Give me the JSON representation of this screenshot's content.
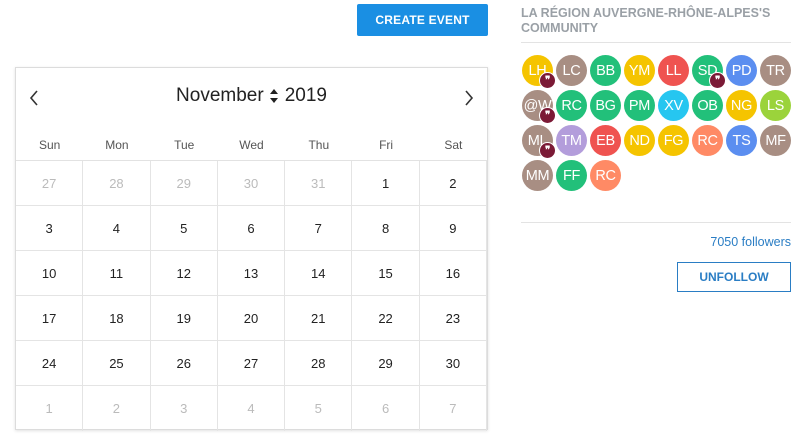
{
  "toolbar": {
    "create_event_label": "CREATE EVENT"
  },
  "calendar": {
    "month": "November",
    "year": "2019",
    "weekdays": [
      "Sun",
      "Mon",
      "Tue",
      "Wed",
      "Thu",
      "Fri",
      "Sat"
    ],
    "weeks": [
      [
        {
          "d": "27",
          "out": true
        },
        {
          "d": "28",
          "out": true
        },
        {
          "d": "29",
          "out": true
        },
        {
          "d": "30",
          "out": true
        },
        {
          "d": "31",
          "out": true
        },
        {
          "d": "1"
        },
        {
          "d": "2"
        }
      ],
      [
        {
          "d": "3"
        },
        {
          "d": "4"
        },
        {
          "d": "5"
        },
        {
          "d": "6"
        },
        {
          "d": "7"
        },
        {
          "d": "8"
        },
        {
          "d": "9"
        }
      ],
      [
        {
          "d": "10"
        },
        {
          "d": "11"
        },
        {
          "d": "12"
        },
        {
          "d": "13"
        },
        {
          "d": "14"
        },
        {
          "d": "15"
        },
        {
          "d": "16"
        }
      ],
      [
        {
          "d": "17"
        },
        {
          "d": "18"
        },
        {
          "d": "19"
        },
        {
          "d": "20"
        },
        {
          "d": "21"
        },
        {
          "d": "22"
        },
        {
          "d": "23"
        }
      ],
      [
        {
          "d": "24"
        },
        {
          "d": "25"
        },
        {
          "d": "26"
        },
        {
          "d": "27"
        },
        {
          "d": "28"
        },
        {
          "d": "29"
        },
        {
          "d": "30"
        }
      ],
      [
        {
          "d": "1",
          "out": true
        },
        {
          "d": "2",
          "out": true
        },
        {
          "d": "3",
          "out": true
        },
        {
          "d": "4",
          "out": true
        },
        {
          "d": "5",
          "out": true
        },
        {
          "d": "6",
          "out": true
        },
        {
          "d": "7",
          "out": true
        }
      ]
    ]
  },
  "community": {
    "title": "LA RÉGION AUVERGNE-RHÔNE-ALPES'S COMMUNITY",
    "badge_glyph": "❞",
    "members": [
      {
        "initials": "LH",
        "color": "#f5c400",
        "badge": true
      },
      {
        "initials": "LC",
        "color": "#a88e83"
      },
      {
        "initials": "BB",
        "color": "#22c07a"
      },
      {
        "initials": "YM",
        "color": "#f5c400"
      },
      {
        "initials": "LL",
        "color": "#ef5350"
      },
      {
        "initials": "SD",
        "color": "#22c07a",
        "badge": true
      },
      {
        "initials": "PD",
        "color": "#5b8ef0"
      },
      {
        "initials": "TR",
        "color": "#a88e83"
      },
      {
        "initials": "@W",
        "color": "#a88e83",
        "badge": true
      },
      {
        "initials": "RC",
        "color": "#22c07a"
      },
      {
        "initials": "BG",
        "color": "#22c07a"
      },
      {
        "initials": "PM",
        "color": "#22c07a"
      },
      {
        "initials": "XV",
        "color": "#26c6f0"
      },
      {
        "initials": "OB",
        "color": "#22c07a"
      },
      {
        "initials": "NG",
        "color": "#f5c400"
      },
      {
        "initials": "LS",
        "color": "#9bd33b"
      },
      {
        "initials": "ML",
        "color": "#a88e83",
        "badge": true
      },
      {
        "initials": "TM",
        "color": "#b39ddb"
      },
      {
        "initials": "EB",
        "color": "#ef5350"
      },
      {
        "initials": "ND",
        "color": "#f5c400"
      },
      {
        "initials": "FG",
        "color": "#f5c400"
      },
      {
        "initials": "RC",
        "color": "#ff8a65"
      },
      {
        "initials": "TS",
        "color": "#5b8ef0"
      },
      {
        "initials": "MF",
        "color": "#a88e83"
      },
      {
        "initials": "MM",
        "color": "#a88e83"
      },
      {
        "initials": "FF",
        "color": "#22c07a"
      },
      {
        "initials": "RC",
        "color": "#ff8a65"
      }
    ],
    "followers_label": "7050 followers",
    "unfollow_label": "UNFOLLOW"
  }
}
